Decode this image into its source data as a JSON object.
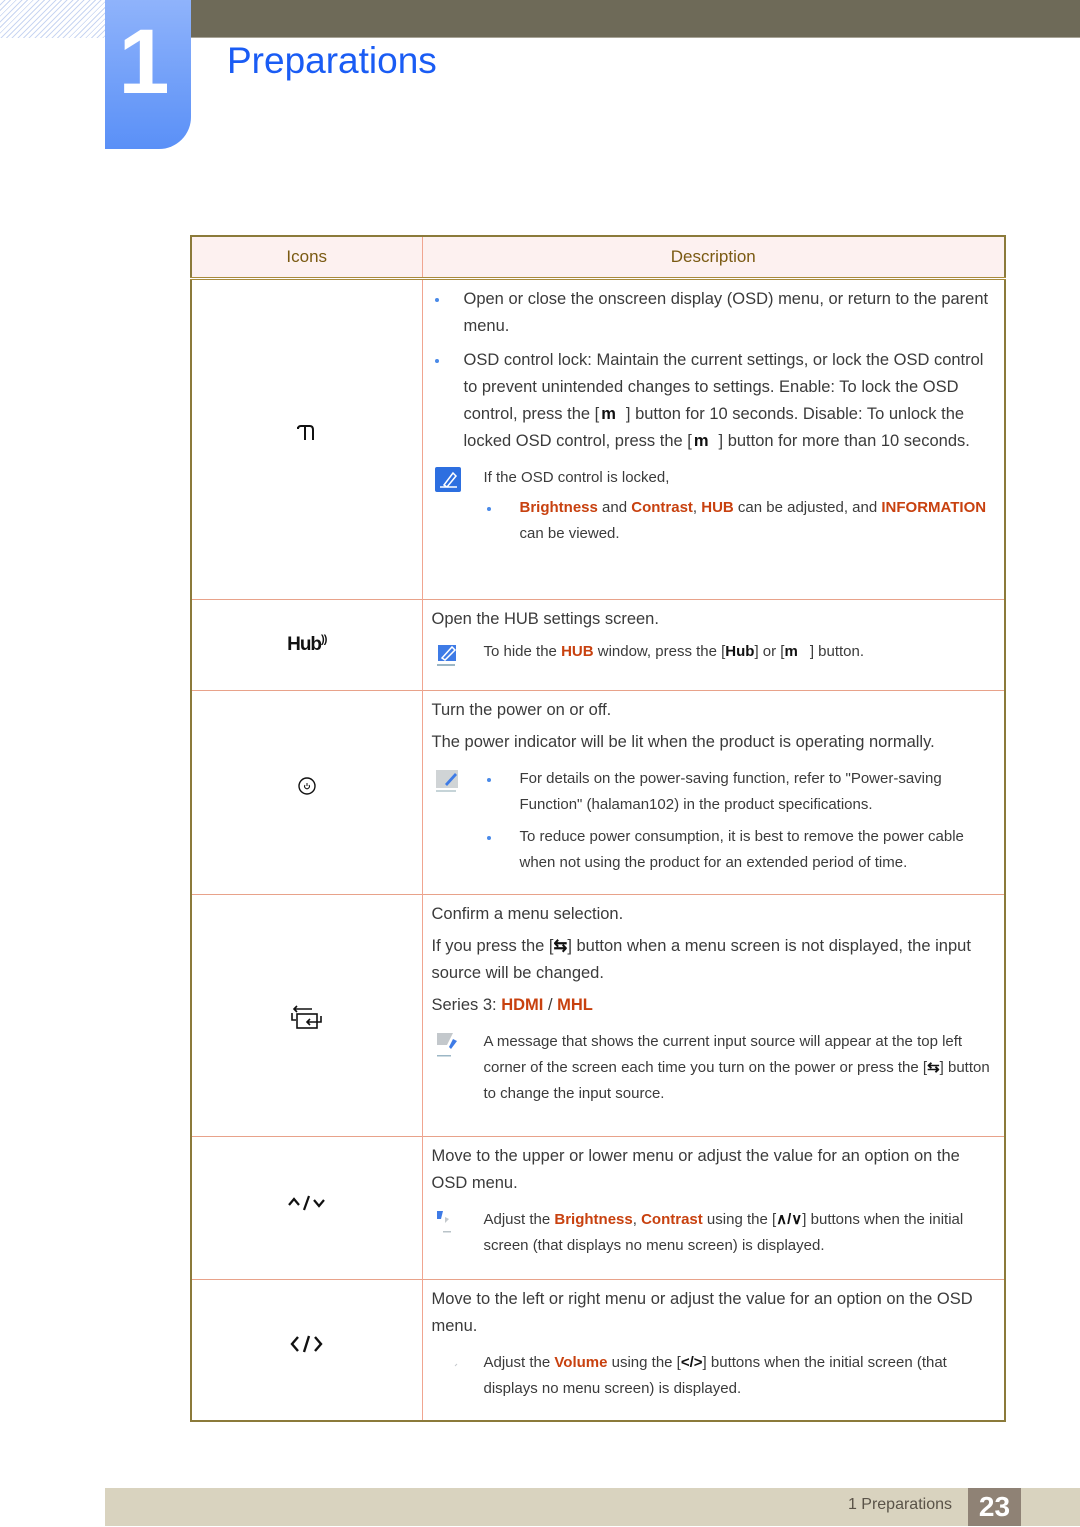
{
  "chapter": {
    "number": "1",
    "title": "Preparations"
  },
  "table": {
    "headers": {
      "icons": "Icons",
      "description": "Description"
    },
    "rows": [
      {
        "icon": "menu-icon",
        "icon_glyph": "m",
        "bullets": [
          "Open or close the onscreen display (OSD) menu, or return to the parent menu.",
          {
            "before_1": "OSD control lock: Maintain the current settings, or lock the OSD control to prevent unintended changes to settings. Enable: To lock the OSD control, press the [",
            "after_1": "] button for 10 seconds. Disable: To unlock the locked OSD control, press the [",
            "after_2": "] button for more than 10 seconds."
          }
        ],
        "note": {
          "intro": "If the OSD control is locked,",
          "sub": {
            "hl1": "Brightness",
            "t1": " and ",
            "hl2": "Contrast",
            "t2": ", ",
            "hl3": "HUB",
            "t3": " can be adjusted, and ",
            "hl4": "INFORMATION",
            "t4": " can be viewed."
          }
        }
      },
      {
        "icon": "hub-icon",
        "icon_glyph": "Hub",
        "paragraphs": [
          "Open the HUB settings screen."
        ],
        "note": {
          "t1": "To hide the ",
          "hl1": "HUB",
          "t2": " window, press the [",
          "t3": "] or [",
          "t4": "] button."
        }
      },
      {
        "icon": "power-icon",
        "paragraphs": [
          "Turn the power on or off.",
          "The power indicator will be lit when the product is operating normally."
        ],
        "note": {
          "bullets": [
            "For details on the power-saving function, refer to \"Power-saving Function\" (halaman102) in the product specifications.",
            "To reduce power consumption, it is best to remove the power cable when not using the product for an extended period of time."
          ]
        }
      },
      {
        "icon": "source-icon",
        "paragraphs": [
          "Confirm a menu selection."
        ],
        "press": {
          "before": "If you press the [",
          "after": "] button when a menu screen is not displayed, the input source will be changed."
        },
        "series": {
          "label": "Series 3: ",
          "hl1": "HDMI",
          "sep": " / ",
          "hl2": "MHL"
        },
        "note": {
          "before": "A message that shows the current input source will appear at the top left corner of the screen each time you turn on the power or press the [",
          "after": "] button to change the input source."
        }
      },
      {
        "icon": "up-down-icon",
        "icon_glyph": "^/v",
        "paragraphs": [
          "Move to the upper or lower menu or adjust the value for an option on the OSD menu."
        ],
        "note": {
          "t1": "Adjust the ",
          "hl1": "Brightness",
          "t2": ", ",
          "hl2": "Contrast",
          "t3": " using the [",
          "t4": "] buttons when the initial screen (that displays no menu screen) is displayed."
        }
      },
      {
        "icon": "left-right-icon",
        "icon_glyph": "</>",
        "paragraphs": [
          "Move to the left or right menu or adjust the value for an option on the OSD menu."
        ],
        "note": {
          "t1": "Adjust the ",
          "hl1": "Volume",
          "t2": " using the [",
          "t3": "] buttons when the initial screen (that displays no menu screen) is displayed."
        }
      }
    ]
  },
  "footer": {
    "section_label": "1 Preparations",
    "page_number": "23"
  },
  "colors": {
    "accent_blue": "#1a5cf4",
    "highlight": "#c8410f",
    "header_text": "#7a5a12"
  }
}
